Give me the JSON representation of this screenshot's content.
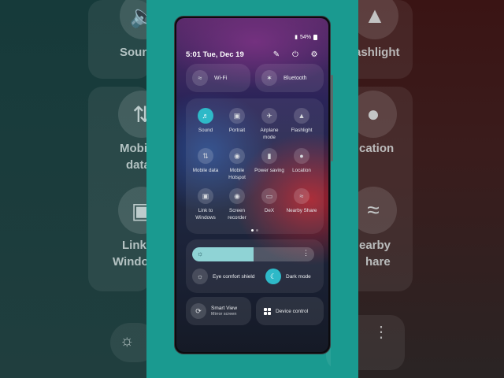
{
  "status_bar": {
    "battery": "54%"
  },
  "header": {
    "time_date": "5:01 Tue, Dec 19"
  },
  "connectivity": [
    {
      "label": "Wi-Fi",
      "icon": "wifi-icon"
    },
    {
      "label": "Bluetooth",
      "icon": "bluetooth-icon"
    }
  ],
  "quick_tiles": [
    {
      "label": "Sound",
      "icon": "sound-icon",
      "active": true
    },
    {
      "label": "Portrait",
      "icon": "portrait-icon",
      "active": false
    },
    {
      "label": "Airplane mode",
      "icon": "airplane-icon",
      "active": false
    },
    {
      "label": "Flashlight",
      "icon": "flashlight-icon",
      "active": false
    },
    {
      "label": "Mobile data",
      "icon": "mobile-data-icon",
      "active": false
    },
    {
      "label": "Mobile Hotspot",
      "icon": "hotspot-icon",
      "active": false
    },
    {
      "label": "Power saving",
      "icon": "power-saving-icon",
      "active": false
    },
    {
      "label": "Location",
      "icon": "location-icon",
      "active": false
    },
    {
      "label": "Link to Windows",
      "icon": "link-to-windows-icon",
      "active": false
    },
    {
      "label": "Screen recorder",
      "icon": "screen-recorder-icon",
      "active": false
    },
    {
      "label": "DeX",
      "icon": "dex-icon",
      "active": false
    },
    {
      "label": "Nearby Share",
      "icon": "nearby-share-icon",
      "active": false
    }
  ],
  "brightness": {
    "level_percent": 50
  },
  "toggles": {
    "eye_comfort": "Eye comfort shield",
    "dark_mode": "Dark mode"
  },
  "cards": {
    "smart_view": {
      "title": "Smart View",
      "subtitle": "Mirror screen"
    },
    "device_control": {
      "title": "Device control"
    }
  },
  "background_left": {
    "label_sound": "Sound",
    "label_mobile_1": "Mobile",
    "label_mobile_2": "data",
    "label_link_1": "Link",
    "label_link_2": "Window"
  },
  "background_right": {
    "label_flash": "ashlight",
    "label_loc": "cation",
    "label_nearby_1": "earby",
    "label_nearby_2": "hare"
  },
  "colors": {
    "accent": "#2eb9c8",
    "side_strip": "#1a9a90"
  }
}
